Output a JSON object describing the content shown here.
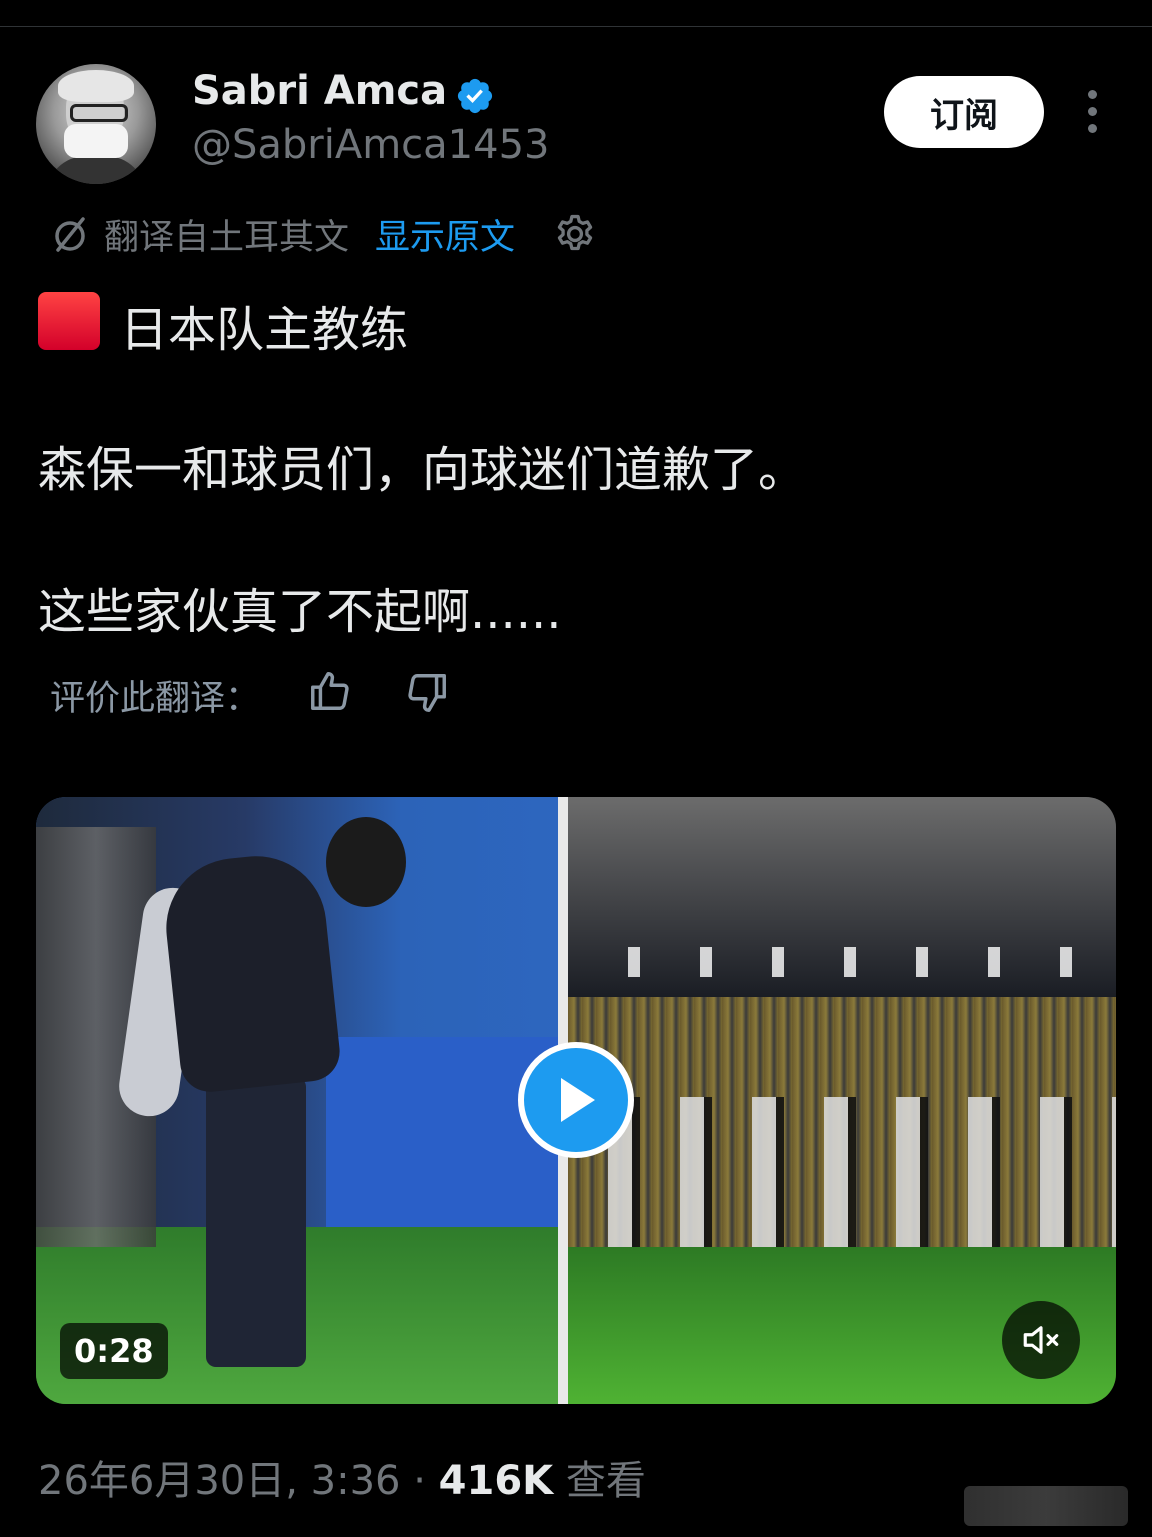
{
  "user": {
    "name": "Sabri Amca",
    "handle": "@SabriAmca1453",
    "verified": true
  },
  "header": {
    "subscribe_label": "订阅",
    "more_icon": "more-vertical-icon"
  },
  "translation": {
    "label": "翻译自土耳其文",
    "show_original": "显示原文"
  },
  "tweet": {
    "line1": "日本队主教练",
    "line2": "森保一和球员们，向球迷们道歉了。",
    "line3": "这些家伙真了不起啊......"
  },
  "rating": {
    "label": "评价此翻译："
  },
  "media": {
    "duration": "0:28"
  },
  "meta": {
    "date": "26年6月30日, 3:36 · ",
    "views": "416K",
    "views_suffix": " 查看"
  },
  "colors": {
    "background": "#000000",
    "accent": "#1d9bf0",
    "secondary_text": "#71767b",
    "primary_text": "#e7e9ea"
  }
}
